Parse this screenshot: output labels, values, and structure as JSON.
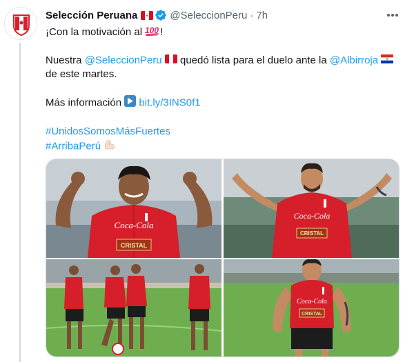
{
  "account": {
    "display_name": "Selección Peruana",
    "handle": "@SeleccionPeru",
    "separator": "·",
    "time": "7h"
  },
  "tweet": {
    "line1_text": "¡Con la motivación al",
    "line2_prefix": "Nuestra",
    "line2_mention": "@SeleccionPeru",
    "line2_mid": "quedó lista para el duelo ante la",
    "line2_mention2": "@Albirroja",
    "line3_text": "de este martes.",
    "info_text": "Más información",
    "info_link": "bit.ly/3INS0f1",
    "hashtag1": "#UnidosSomosMásFuertes",
    "hashtag2": "#ArribaPerú"
  },
  "photos": {
    "sponsor_text": "Coca-Cola",
    "sponsor_text_2": "CRISTAL"
  },
  "icons": {
    "more": "more-horizontal-icon",
    "verified": "verified-badge-icon",
    "peru_flag": "peru-flag-icon",
    "paraguay_flag": "paraguay-flag-icon",
    "hundred": "hundred-points-emoji",
    "info_arrow": "play-button-emoji",
    "bicep": "flexed-biceps-emoji"
  },
  "colors": {
    "link": "#1d9bf0",
    "muted": "#536471",
    "jersey": "#d61f2b",
    "pitch": "#6fae4f"
  }
}
